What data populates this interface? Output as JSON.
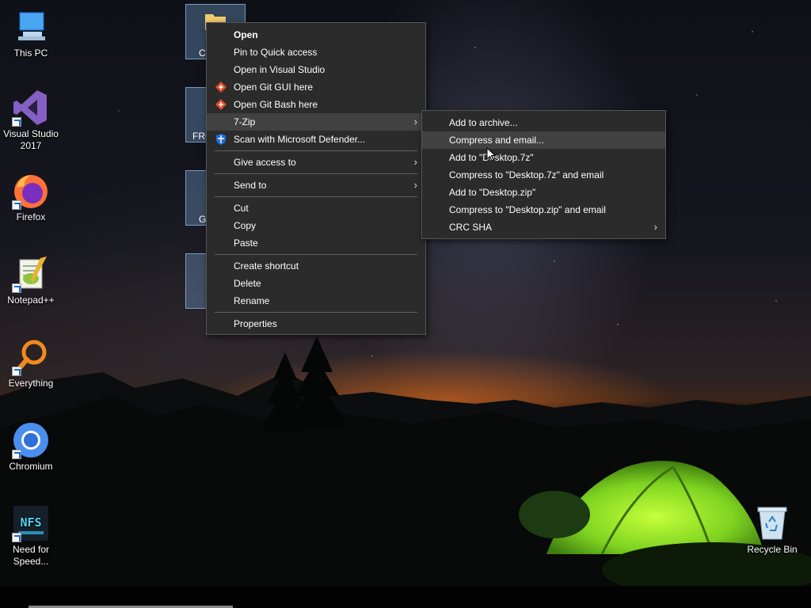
{
  "desktop": {
    "icons": [
      {
        "label": "This PC",
        "icon": "monitor-icon"
      },
      {
        "label": "Visual Studio 2017",
        "icon": "visual-studio-icon"
      },
      {
        "label": "Firefox",
        "icon": "firefox-icon"
      },
      {
        "label": "Notepad++",
        "icon": "notepadpp-icon"
      },
      {
        "label": "Everything",
        "icon": "search-magnifier-icon"
      },
      {
        "label": "Chromium",
        "icon": "chromium-icon"
      },
      {
        "label": "Need for Speed...",
        "icon": "nfs-icon"
      },
      {
        "label": "Recycle Bin",
        "icon": "recycle-bin-icon"
      }
    ],
    "partial_labels": [
      "C",
      "FRO",
      "G"
    ]
  },
  "context_menu": {
    "items": [
      {
        "label": "Open"
      },
      {
        "label": "Pin to Quick access"
      },
      {
        "label": "Open in Visual Studio"
      },
      {
        "label": "Open Git GUI here"
      },
      {
        "label": "Open Git Bash here"
      },
      {
        "label": "7-Zip"
      },
      {
        "label": "Scan with Microsoft Defender..."
      },
      {
        "label": "Give access to"
      },
      {
        "label": "Send to"
      },
      {
        "label": "Cut"
      },
      {
        "label": "Copy"
      },
      {
        "label": "Paste"
      },
      {
        "label": "Create shortcut"
      },
      {
        "label": "Delete"
      },
      {
        "label": "Rename"
      },
      {
        "label": "Properties"
      }
    ]
  },
  "submenu_7zip": {
    "items": [
      {
        "label": "Add to archive..."
      },
      {
        "label": "Compress and email..."
      },
      {
        "label": "Add to \"Desktop.7z\""
      },
      {
        "label": "Compress to \"Desktop.7z\" and email"
      },
      {
        "label": "Add to \"Desktop.zip\""
      },
      {
        "label": "Compress to \"Desktop.zip\" and email"
      },
      {
        "label": "CRC SHA"
      }
    ]
  },
  "colors": {
    "menu_bg": "#2b2b2b",
    "menu_hover": "#414141",
    "tent_green": "#7ed321"
  }
}
